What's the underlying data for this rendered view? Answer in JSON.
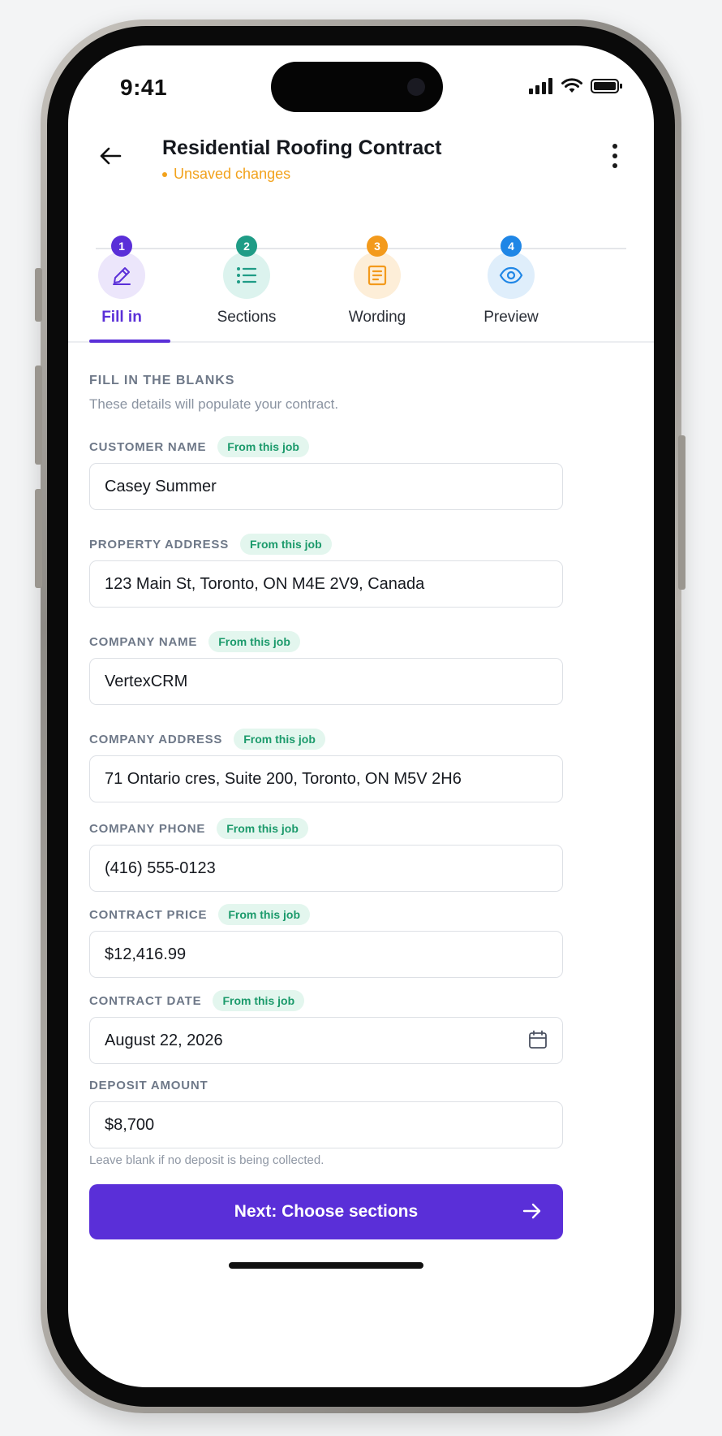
{
  "status": {
    "time": "9:41"
  },
  "header": {
    "title": "Residential Roofing Contract",
    "subtitle": "Unsaved changes"
  },
  "steps": [
    {
      "number": "1",
      "label": "Fill in",
      "color": "#5a2fd8",
      "bg": "#ece6fb",
      "icon": "pencil-icon",
      "active": true
    },
    {
      "number": "2",
      "label": "Sections",
      "color": "#1f9c86",
      "bg": "#dcf3ee",
      "icon": "list-icon",
      "active": false
    },
    {
      "number": "3",
      "label": "Wording",
      "color": "#f39a1c",
      "bg": "#fdeed8",
      "icon": "document-icon",
      "active": false
    },
    {
      "number": "4",
      "label": "Preview",
      "color": "#1f86e6",
      "bg": "#dfeefb",
      "icon": "eye-icon",
      "active": false
    }
  ],
  "form": {
    "section_title": "FILL IN THE BLANKS",
    "section_subtitle": "These details will populate your contract.",
    "badge_text": "From this job",
    "fields": [
      {
        "label": "CUSTOMER NAME",
        "value": "Casey Summer",
        "badge": true
      },
      {
        "label": "PROPERTY ADDRESS",
        "value": "123 Main St, Toronto, ON M4E 2V9, Canada",
        "badge": true
      },
      {
        "label": "COMPANY NAME",
        "value": "VertexCRM",
        "badge": true
      },
      {
        "label": "COMPANY ADDRESS",
        "value": "71 Ontario cres, Suite 200, Toronto, ON M5V 2H6",
        "badge": true
      },
      {
        "label": "COMPANY PHONE",
        "value": "(416) 555-0123",
        "badge": true
      },
      {
        "label": "CONTRACT PRICE",
        "value": "$12,416.99",
        "badge": true
      },
      {
        "label": "CONTRACT DATE",
        "value": "August 22, 2026",
        "badge": true
      },
      {
        "label": "DEPOSIT AMOUNT",
        "value": "$8,700",
        "badge": false
      }
    ],
    "deposit_hint": "Leave blank if no deposit is being collected."
  },
  "footer": {
    "next_label": "Next: Choose sections"
  },
  "colors": {
    "accent": "#5a2fd8",
    "warning": "#f2a21c",
    "badge_text": "#1b9a6b",
    "badge_bg": "#e3f6ee"
  }
}
